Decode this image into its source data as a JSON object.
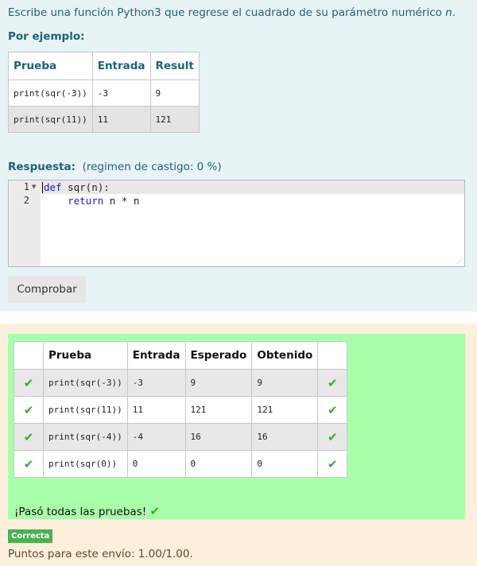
{
  "question": {
    "text_before": "Escribe una función Python3 que regrese el cuadrado de su parámetro numérico ",
    "text_param": "n",
    "text_after": ".",
    "example_label": "Por ejemplo:",
    "example_table": {
      "headers": [
        "Prueba",
        "Entrada",
        "Result"
      ],
      "rows": [
        [
          "print(sqr(-3))",
          "-3",
          "9"
        ],
        [
          "print(sqr(11))",
          "11",
          "121"
        ]
      ]
    },
    "answer_label": "Respuesta:",
    "penalty_text": "(regimen de castigo: 0 %)",
    "editor": {
      "line_numbers": [
        "1",
        "2"
      ],
      "lines": [
        {
          "keyword": "def",
          "rest": " sqr(n):"
        },
        {
          "indent": "    ",
          "keyword": "return",
          "rest": " n * n"
        }
      ]
    },
    "check_button": "Comprobar"
  },
  "feedback": {
    "table": {
      "headers": [
        "",
        "Prueba",
        "Entrada",
        "Esperado",
        "Obtenido",
        ""
      ],
      "rows": [
        {
          "test": "print(sqr(-3))",
          "input": "-3",
          "expected": "9",
          "got": "9",
          "status": "correct"
        },
        {
          "test": "print(sqr(11))",
          "input": "11",
          "expected": "121",
          "got": "121",
          "status": "correct"
        },
        {
          "test": "print(sqr(-4))",
          "input": "-4",
          "expected": "16",
          "got": "16",
          "status": "correct"
        },
        {
          "test": "print(sqr(0))",
          "input": "0",
          "expected": "0",
          "got": "0",
          "status": "correct"
        }
      ]
    },
    "all_passed": "¡Pasó todas las pruebas!",
    "badge": "Correcta",
    "points": "Puntos para este envío: 1.00/1.00."
  },
  "icons": {
    "check": "check-icon",
    "fold": "fold-arrow-icon",
    "resize": "resize-handle-icon"
  },
  "colors": {
    "question_bg": "#e7f3f5",
    "feedback_bg": "#fcefdc",
    "results_bg": "#aaffaa",
    "tick": "#3aaa35",
    "badge": "#4cb050",
    "keyword": "#1a1acc"
  }
}
